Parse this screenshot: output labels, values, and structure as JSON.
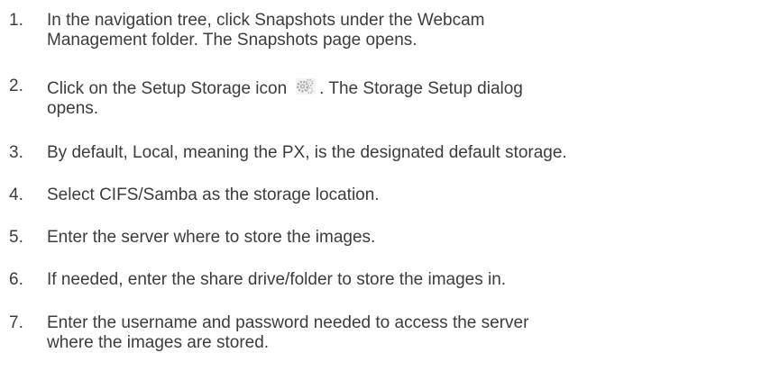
{
  "steps": [
    {
      "number": "1.",
      "lines": [
        "In the navigation tree, click Snapshots under the Webcam",
        "Management folder. The Snapshots page opens."
      ]
    },
    {
      "number": "2.",
      "before_icon": "Click on the Setup Storage icon",
      "icon": "setup-storage-gear-icon",
      "after_icon": ". The Storage Setup dialog",
      "line2": "opens."
    },
    {
      "number": "3.",
      "lines": [
        "By default, Local, meaning the PX, is the designated default storage."
      ]
    },
    {
      "number": "4.",
      "lines": [
        "Select CIFS/Samba as the storage location."
      ]
    },
    {
      "number": "5.",
      "lines": [
        "Enter the server where to store the images."
      ]
    },
    {
      "number": "6.",
      "lines": [
        "If needed, enter the share drive/folder to store the images in."
      ]
    },
    {
      "number": "7.",
      "lines": [
        "Enter the username and password needed to access the server",
        "where the images are stored."
      ]
    }
  ]
}
